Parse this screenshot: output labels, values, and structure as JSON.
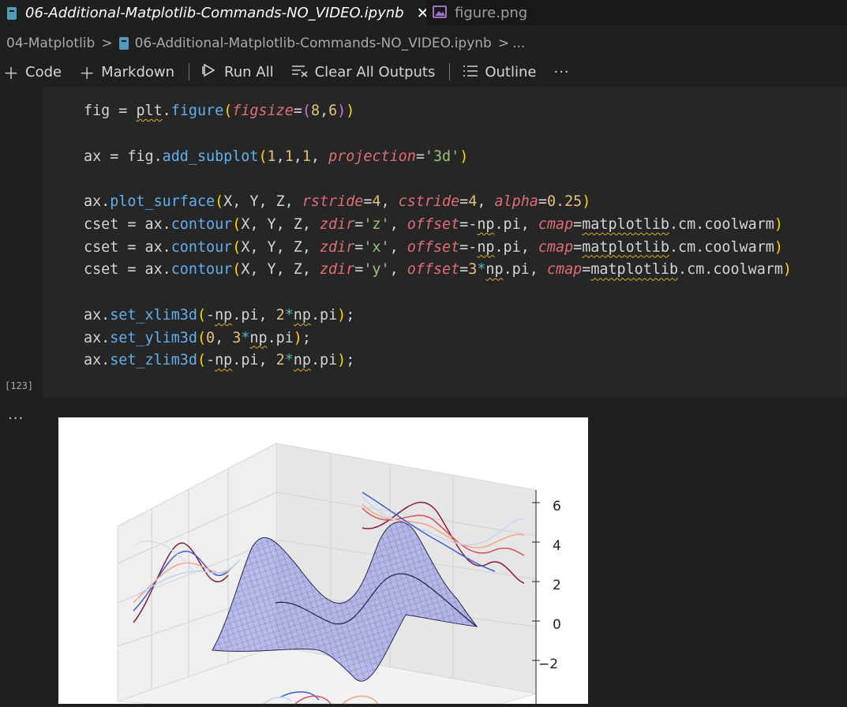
{
  "tabs": [
    {
      "label": "06-Additional-Matplotlib-Commands-NO_VIDEO.ipynb",
      "active": true,
      "close": "✕"
    },
    {
      "label": "figure.png",
      "active": false
    }
  ],
  "breadcrumb": {
    "folder": "04-Matplotlib",
    "file": "06-Additional-Matplotlib-Commands-NO_VIDEO.ipynb",
    "more": "..."
  },
  "toolbar": {
    "code": "Code",
    "markdown": "Markdown",
    "run_all": "Run All",
    "clear_all": "Clear All Outputs",
    "outline": "Outline",
    "more": "···"
  },
  "cell": {
    "execution_count": "[123]",
    "output_more": "···"
  },
  "figure": {
    "zticks": [
      "6",
      "4",
      "2",
      "0",
      "−2"
    ]
  },
  "colors": {
    "accent_blue": "#61afef",
    "keyword": "#e06c75",
    "string": "#98c379",
    "number": "#e5c07b"
  }
}
